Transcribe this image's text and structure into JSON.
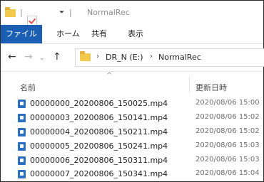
{
  "window": {
    "title": "NormalRec"
  },
  "quick_access": {
    "separator": "|",
    "separator2": "|",
    "dropdown_icon": "chevron-down-icon"
  },
  "ribbon": {
    "tabs": [
      {
        "label": "ファイル",
        "active": true
      },
      {
        "label": "ホーム",
        "active": false
      },
      {
        "label": "共有",
        "active": false
      },
      {
        "label": "表示",
        "active": false
      }
    ]
  },
  "nav": {
    "back": "←",
    "forward": "→",
    "dropdown": "⌄",
    "up": "↑"
  },
  "address": {
    "separator": "›",
    "crumbs": [
      "DR_N (E:)",
      "NormalRec"
    ]
  },
  "columns": {
    "name": "名前",
    "date": "更新日時",
    "sort_indicator": "^"
  },
  "files": [
    {
      "name": "00000000_20200806_150025.mp4",
      "date": "2020/08/06 15:00"
    },
    {
      "name": "00000003_20200806_150141.mp4",
      "date": "2020/08/06 15:02"
    },
    {
      "name": "00000004_20200806_150211.mp4",
      "date": "2020/08/06 15:02"
    },
    {
      "name": "00000005_20200806_150241.mp4",
      "date": "2020/08/06 15:03"
    },
    {
      "name": "00000006_20200806_150311.mp4",
      "date": "2020/08/06 15:03"
    },
    {
      "name": "00000007_20200806_150341.mp4",
      "date": "2020/08/06 15:04"
    }
  ],
  "colors": {
    "accent": "#1b5fb5",
    "folder": "#f2c94c",
    "file_icon": "#2d6fc0"
  }
}
